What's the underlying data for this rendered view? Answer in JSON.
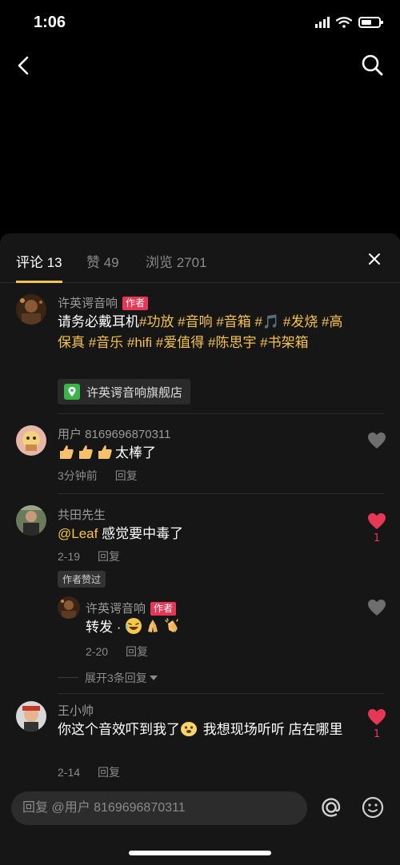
{
  "status_bar": {
    "time": "1:06"
  },
  "tabs": [
    {
      "label": "评论 13",
      "active": true
    },
    {
      "label": "赞 49",
      "active": false
    },
    {
      "label": "浏览 2701",
      "active": false
    }
  ],
  "comments": [
    {
      "user": "许英谔音响",
      "badge": "作者",
      "text_plain": "请务必戴耳机",
      "text_tags": "#功放 #音响 #音箱 #🎵 #发烧 #高保真 #音乐 #hifi #爱值得 #陈思宇 #书架箱",
      "store_label": "许英谔音响旗舰店"
    },
    {
      "user": "用户 8169696870311",
      "text": "太棒了",
      "time": "3分钟前",
      "reply_label": "回复"
    },
    {
      "user": "共田先生",
      "mention": "@Leaf",
      "text": " 感觉要中毒了",
      "time": "2-19",
      "reply_label": "回复",
      "author_liked": "作者赞过",
      "like_count": "1",
      "reply": {
        "user": "许英谔音响",
        "badge": "作者",
        "text": "转发 · ",
        "time": "2-20",
        "reply_label": "回复"
      },
      "expand_label": "展开3条回复"
    },
    {
      "user": "王小帅",
      "text_before": "你这个音效吓到我了",
      "text_after": " 我想现场听听 店在哪里",
      "time": "2-14",
      "reply_label": "回复",
      "like_count": "1"
    }
  ],
  "input": {
    "placeholder": "回复 @用户 8169696870311"
  },
  "colors": {
    "accent": "#f6c342",
    "like": "#e63756",
    "sheet_bg": "#161616"
  }
}
